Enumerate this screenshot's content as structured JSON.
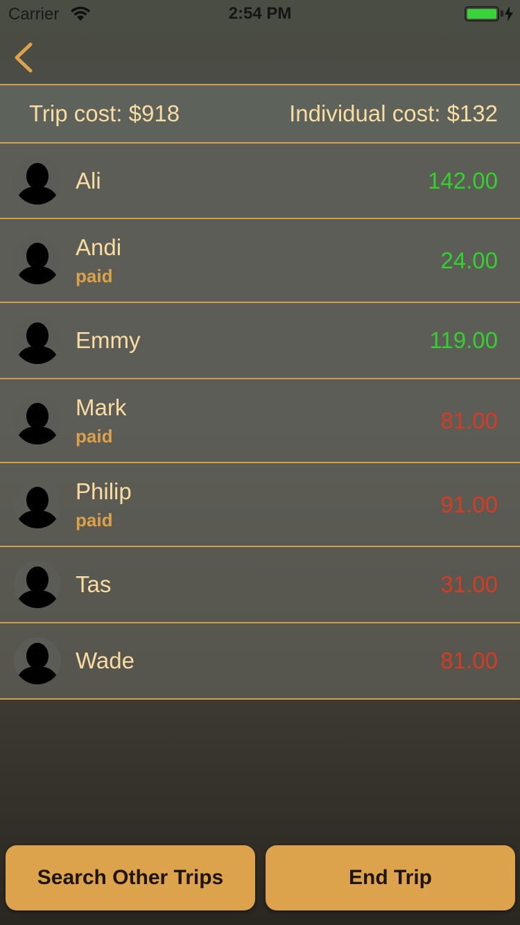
{
  "status_bar": {
    "carrier": "Carrier",
    "time": "2:54 PM"
  },
  "nav": {
    "back_icon": "chevron-left-icon"
  },
  "summary": {
    "trip_cost": "Trip cost: $918",
    "individual_cost": "Individual cost: $132"
  },
  "members": [
    {
      "name": "Ali",
      "paid": "",
      "amount": "142.00",
      "sign": "pos"
    },
    {
      "name": "Andi",
      "paid": "paid",
      "amount": "24.00",
      "sign": "pos"
    },
    {
      "name": "Emmy",
      "paid": "",
      "amount": "119.00",
      "sign": "pos"
    },
    {
      "name": "Mark",
      "paid": "paid",
      "amount": "81.00",
      "sign": "neg"
    },
    {
      "name": "Philip",
      "paid": "paid",
      "amount": "91.00",
      "sign": "neg"
    },
    {
      "name": "Tas",
      "paid": "",
      "amount": "31.00",
      "sign": "neg"
    },
    {
      "name": "Wade",
      "paid": "",
      "amount": "81.00",
      "sign": "neg"
    }
  ],
  "buttons": {
    "search": "Search Other Trips",
    "end": "End Trip"
  },
  "colors": {
    "accent": "#dca24c",
    "positive": "#34d02e",
    "negative": "#d83a22",
    "text": "#f8dca2"
  }
}
